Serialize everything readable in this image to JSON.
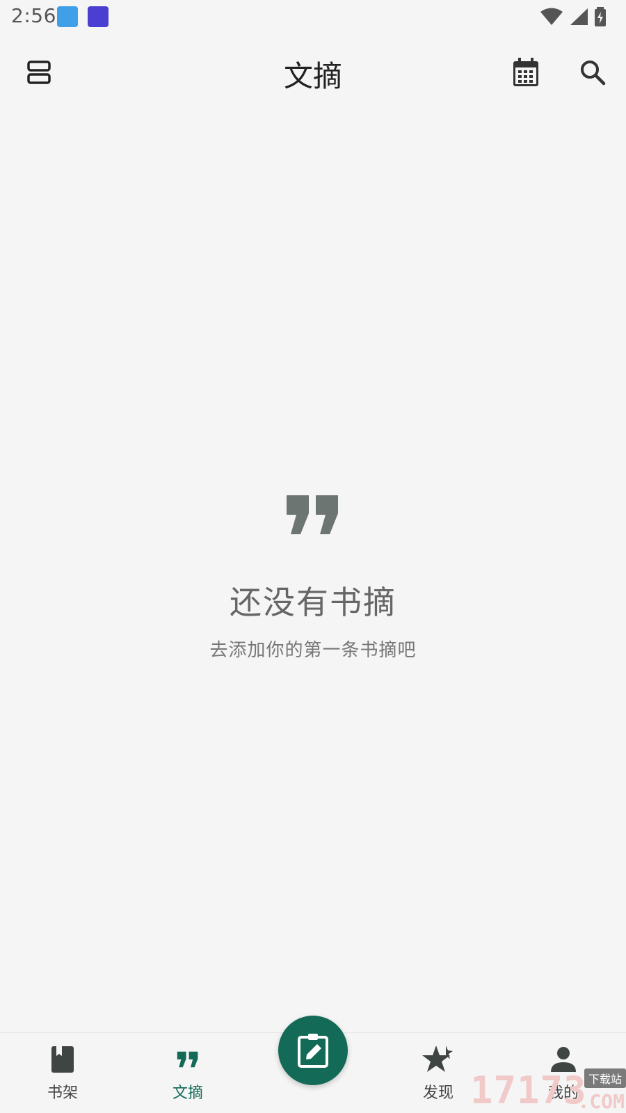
{
  "status_bar": {
    "time": "2:56",
    "notification_icons": [
      "app-notification-icon",
      "app-notification-icon"
    ],
    "system_icons": [
      "wifi-icon",
      "cellular-signal-icon",
      "battery-charging-icon"
    ]
  },
  "app_bar": {
    "title": "文摘",
    "left_action_icon": "view-agenda-icon",
    "right_action_icons": [
      "calendar-icon",
      "search-icon"
    ]
  },
  "empty_state": {
    "icon": "quote-icon",
    "title": "还没有书摘",
    "subtitle": "去添加你的第一条书摘吧"
  },
  "bottom_nav": {
    "items": [
      {
        "label": "书架",
        "icon": "book-icon",
        "active": false
      },
      {
        "label": "文摘",
        "icon": "quote-icon",
        "active": true
      },
      {
        "label": "发现",
        "icon": "sparkle-star-icon",
        "active": false
      },
      {
        "label": "我的",
        "icon": "person-icon",
        "active": false
      }
    ],
    "fab_icon": "clipboard-edit-icon"
  },
  "colors": {
    "accent": "#136b57",
    "background": "#f5f5f5",
    "icon_gray": "#6d7572"
  },
  "watermark": {
    "digits": "17173",
    "tag": "下载站",
    "suffix": ".COM"
  }
}
